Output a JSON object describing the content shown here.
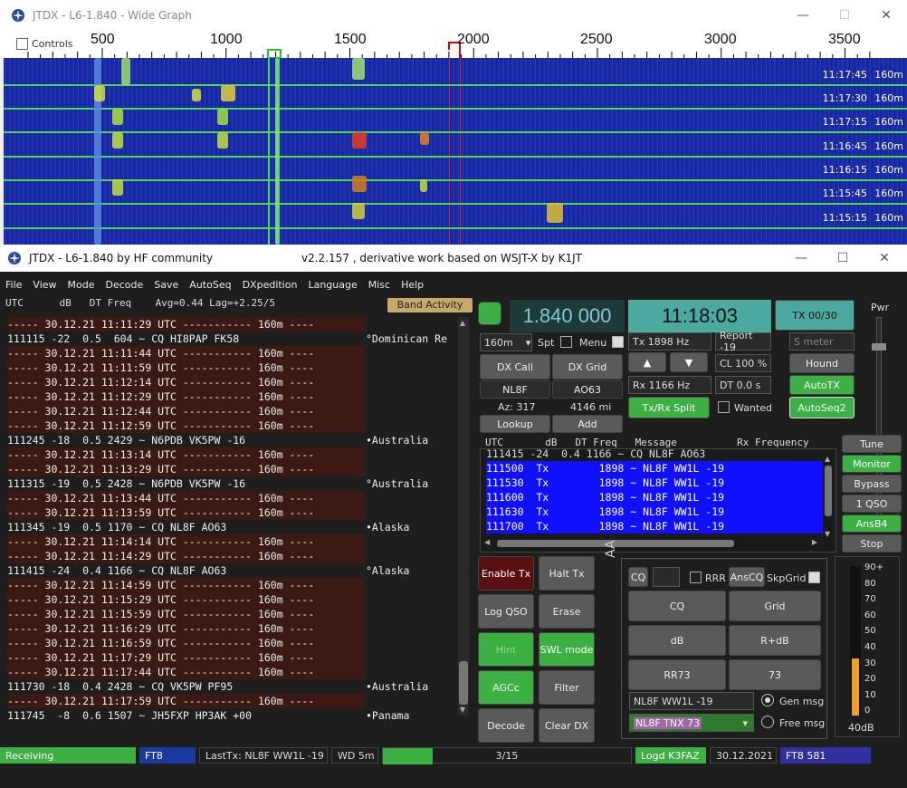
{
  "wide_graph": {
    "title": "JTDX - L6-1.840 - Wide Graph",
    "controls_label": "Controls",
    "freq_ticks": [
      "500",
      "1000",
      "1500",
      "2000",
      "2500",
      "3000",
      "3500"
    ],
    "rows": [
      {
        "time": "11:17:45",
        "band": "160m"
      },
      {
        "time": "11:17:30",
        "band": "160m"
      },
      {
        "time": "11:17:15",
        "band": "160m"
      },
      {
        "time": "11:16:45",
        "band": "160m"
      },
      {
        "time": "11:16:15",
        "band": "160m"
      },
      {
        "time": "11:15:45",
        "band": "160m"
      },
      {
        "time": "11:15:15",
        "band": "160m"
      }
    ]
  },
  "main": {
    "title_left": "JTDX - L6-1.840  by HF community",
    "title_right": "v2.2.157 , derivative work based on WSJT-X by K1JT",
    "menu": [
      "File",
      "View",
      "Mode",
      "Decode",
      "Save",
      "AutoSeq",
      "DXpedition",
      "Language",
      "Misc",
      "Help"
    ],
    "list_header": "UTC      dB   DT Freq    Avg=0.44 Lag=+2.25/5",
    "band_activity": "Band Activity",
    "decodes": [
      {
        "t": "sep",
        "text": "----- 30.12.21 11:11:29 UTC ----------- 160m ----"
      },
      {
        "t": "msg",
        "text": "111115 -22  0.5  604 ~ CQ HI8PAP FK58",
        "c": "°Dominican Re"
      },
      {
        "t": "sep",
        "text": "----- 30.12.21 11:11:44 UTC ----------- 160m ----"
      },
      {
        "t": "sep",
        "text": "----- 30.12.21 11:11:59 UTC ----------- 160m ----"
      },
      {
        "t": "sep",
        "text": "----- 30.12.21 11:12:14 UTC ----------- 160m ----"
      },
      {
        "t": "sep",
        "text": "----- 30.12.21 11:12:29 UTC ----------- 160m ----"
      },
      {
        "t": "sep",
        "text": "----- 30.12.21 11:12:44 UTC ----------- 160m ----"
      },
      {
        "t": "sep",
        "text": "----- 30.12.21 11:12:59 UTC ----------- 160m ----"
      },
      {
        "t": "msg",
        "text": "111245 -18  0.5 2429 ~ N6PDB VK5PW -16",
        "c": "•Australia"
      },
      {
        "t": "sep",
        "text": "----- 30.12.21 11:13:14 UTC ----------- 160m ----"
      },
      {
        "t": "sep",
        "text": "----- 30.12.21 11:13:29 UTC ----------- 160m ----"
      },
      {
        "t": "msg",
        "text": "111315 -19  0.5 2428 ~ N6PDB VK5PW -16",
        "c": "°Australia"
      },
      {
        "t": "sep",
        "text": "----- 30.12.21 11:13:44 UTC ----------- 160m ----"
      },
      {
        "t": "sep",
        "text": "----- 30.12.21 11:13:59 UTC ----------- 160m ----"
      },
      {
        "t": "msg",
        "text": "111345 -19  0.5 1170 ~ CQ NL8F AO63",
        "c": "•Alaska"
      },
      {
        "t": "sep",
        "text": "----- 30.12.21 11:14:14 UTC ----------- 160m ----"
      },
      {
        "t": "sep",
        "text": "----- 30.12.21 11:14:29 UTC ----------- 160m ----"
      },
      {
        "t": "msg",
        "text": "111415 -24  0.4 1166 ~ CQ NL8F AO63",
        "c": "°Alaska"
      },
      {
        "t": "sep",
        "text": "----- 30.12.21 11:14:59 UTC ----------- 160m ----"
      },
      {
        "t": "sep",
        "text": "----- 30.12.21 11:15:29 UTC ----------- 160m ----"
      },
      {
        "t": "sep",
        "text": "----- 30.12.21 11:15:59 UTC ----------- 160m ----"
      },
      {
        "t": "sep",
        "text": "----- 30.12.21 11:16:29 UTC ----------- 160m ----"
      },
      {
        "t": "sep",
        "text": "----- 30.12.21 11:16:59 UTC ----------- 160m ----"
      },
      {
        "t": "sep",
        "text": "----- 30.12.21 11:17:29 UTC ----------- 160m ----"
      },
      {
        "t": "sep",
        "text": "----- 30.12.21 11:17:44 UTC ----------- 160m ----"
      },
      {
        "t": "msg",
        "text": "111730 -18  0.4 2428 ~ CQ VK5PW PF95",
        "c": "•Australia"
      },
      {
        "t": "sep",
        "text": "----- 30.12.21 11:17:59 UTC ----------- 160m ----"
      },
      {
        "t": "msg",
        "text": "111745  -8  0.6 1507 ~ JH5FXP HP3AK +00",
        "c": "•Panama"
      }
    ],
    "freq_display": "1.840 000",
    "clock": "11:18:03",
    "tx_counter": "TX 00/30",
    "pwr_label": "Pwr",
    "band_select": "160m",
    "spt_label": "Spt",
    "menu_label": "Menu",
    "tx_hz": "Tx  1898  Hz",
    "rx_hz": "Rx  1166  Hz",
    "report": "Report -19",
    "s_meter": "S meter",
    "dx_call_btn": "DX Call",
    "dx_grid_btn": "DX Grid",
    "dx_call": "NL8F",
    "dx_grid": "AO63",
    "az": "Az: 317",
    "dist": "4146 mi",
    "lookup": "Lookup",
    "add": "Add",
    "cl": "CL  100 %",
    "dt": "DT 0.0 s",
    "hound": "Hound",
    "autotx": "AutoTX",
    "txrx_split": "Tx/Rx Split",
    "wanted": "Wanted",
    "autoseq2": "AutoSeq2",
    "rx_header": "UTC       dB   DT Freq   Message          Rx Frequency",
    "rx_first": "111415 -24  0.4 1166 ~ CQ NL8F AO63",
    "tx_rows": [
      "111500  Tx        1898 ~ NL8F WW1L -19",
      "111530  Tx        1898 ~ NL8F WW1L -19",
      "111600  Tx        1898 ~ NL8F WW1L -19",
      "111630  Tx        1898 ~ NL8F WW1L -19",
      "111700  Tx        1898 ~ NL8F WW1L -19"
    ],
    "side_buttons": [
      "Tune",
      "Monitor",
      "Bypass",
      "1 QSO",
      "AnsB4",
      "Stop"
    ],
    "enable_tx": "Enable Tx",
    "halt_tx": "Halt Tx",
    "log_qso": "Log QSO",
    "erase": "Erase",
    "hint": "Hint",
    "swl_mode": "SWL mode",
    "agcc": "AGCc",
    "filter": "Filter",
    "decode": "Decode",
    "clear_dx": "Clear DX",
    "cq_small": "CQ",
    "rrr": "RRR",
    "anscq": "AnsCQ",
    "skpgrid": "SkpGrid",
    "msg_btns": [
      "CQ",
      "Grid",
      "dB",
      "R+dB",
      "RR73",
      "73"
    ],
    "gen_msg_text": "NL8F WW1L -19",
    "free_msg_text": "NL8F TNX 73",
    "gen_msg": "Gen msg",
    "free_msg": "Free msg",
    "meter_ticks": [
      "90+",
      "80",
      "70",
      "60",
      "50",
      "40",
      "30",
      "20",
      "10",
      "0"
    ],
    "meter_db": "40dB",
    "meter_level": 0.38,
    "status": {
      "receiving": "Receiving",
      "mode": "FT8",
      "lasttx": "LastTx: NL8F WW1L -19",
      "wd": "WD 5m",
      "progress": "3/15",
      "logd": "Logd K3FAZ",
      "date": "30.12.2021",
      "mode2": "FT8  581"
    }
  }
}
